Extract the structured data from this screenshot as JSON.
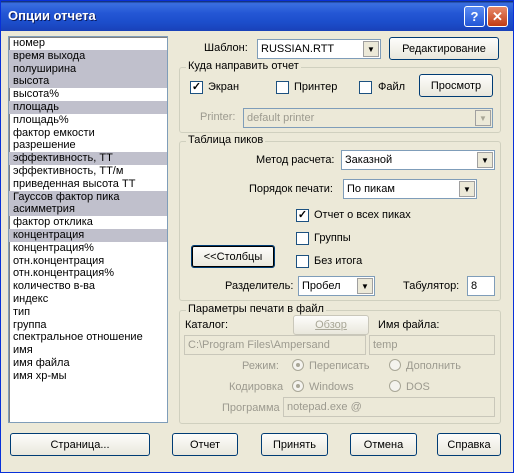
{
  "window": {
    "title": "Опции отчета",
    "help_glyph": "?",
    "close_glyph": "✕"
  },
  "list": {
    "items": [
      {
        "label": "номер",
        "selected": false
      },
      {
        "label": "время выхода",
        "selected": true
      },
      {
        "label": "полуширина",
        "selected": true
      },
      {
        "label": "высота",
        "selected": true
      },
      {
        "label": "высота%",
        "selected": false
      },
      {
        "label": "площадь",
        "selected": true
      },
      {
        "label": "площадь%",
        "selected": false
      },
      {
        "label": "фактор емкости",
        "selected": false
      },
      {
        "label": "разрешение",
        "selected": false
      },
      {
        "label": "эффективность, ТТ",
        "selected": true
      },
      {
        "label": "эффективность, ТТ/м",
        "selected": false
      },
      {
        "label": "приведенная высота ТТ",
        "selected": false
      },
      {
        "label": "Гауссов фактор пика",
        "selected": true
      },
      {
        "label": "асимметрия",
        "selected": true
      },
      {
        "label": "фактор отклика",
        "selected": false
      },
      {
        "label": "концентрация",
        "selected": true
      },
      {
        "label": "концентрация%",
        "selected": false
      },
      {
        "label": "отн.концентрация",
        "selected": false
      },
      {
        "label": "отн.концентрация%",
        "selected": false
      },
      {
        "label": "количество в-ва",
        "selected": false
      },
      {
        "label": "индекс",
        "selected": false
      },
      {
        "label": "тип",
        "selected": false
      },
      {
        "label": "группа",
        "selected": false
      },
      {
        "label": "спектральное отношение",
        "selected": false
      },
      {
        "label": "имя",
        "selected": false
      },
      {
        "label": "имя файла",
        "selected": false
      },
      {
        "label": "имя хр-мы",
        "selected": false
      }
    ]
  },
  "template": {
    "label": "Шаблон:",
    "value": "RUSSIAN.RTT",
    "edit_button": "Редактирование"
  },
  "destination": {
    "group_title": "Куда направить отчет",
    "screen_label": "Экран",
    "screen_checked": true,
    "printer_label": "Принтер",
    "printer_checked": false,
    "file_label": "Файл",
    "file_checked": false,
    "preview_button": "Просмотр",
    "printer_field_label": "Printer:",
    "printer_value": "default printer"
  },
  "peaks": {
    "group_title": "Таблица пиков",
    "method_label": "Метод расчета:",
    "method_value": "Заказной",
    "order_label": "Порядок печати:",
    "order_value": "По пикам",
    "report_all_label": "Отчет о всех пиках",
    "report_all_checked": true,
    "groups_label": "Группы",
    "groups_checked": false,
    "no_total_label": "Без итога",
    "no_total_checked": false,
    "columns_button": "<<Столбцы",
    "separator_label": "Разделитель:",
    "separator_value": "Пробел",
    "tab_label": "Табулятор:",
    "tab_value": "8"
  },
  "file_print": {
    "group_title": "Параметры печати в файл",
    "catalog_label": "Каталог:",
    "browse_button": "Обзор",
    "filename_label": "Имя файла:",
    "catalog_value": "C:\\Program Files\\Ampersand",
    "filename_value": "temp",
    "mode_label": "Режим:",
    "overwrite_label": "Переписать",
    "overwrite_on": true,
    "append_label": "Дополнить",
    "append_on": false,
    "encoding_label": "Кодировка",
    "windows_label": "Windows",
    "windows_on": true,
    "dos_label": "DOS",
    "dos_on": false,
    "program_label": "Программа",
    "program_value": "notepad.exe @"
  },
  "buttons": {
    "page": "Страница...",
    "report": "Отчет",
    "apply": "Принять",
    "cancel": "Отмена",
    "help": "Справка"
  }
}
